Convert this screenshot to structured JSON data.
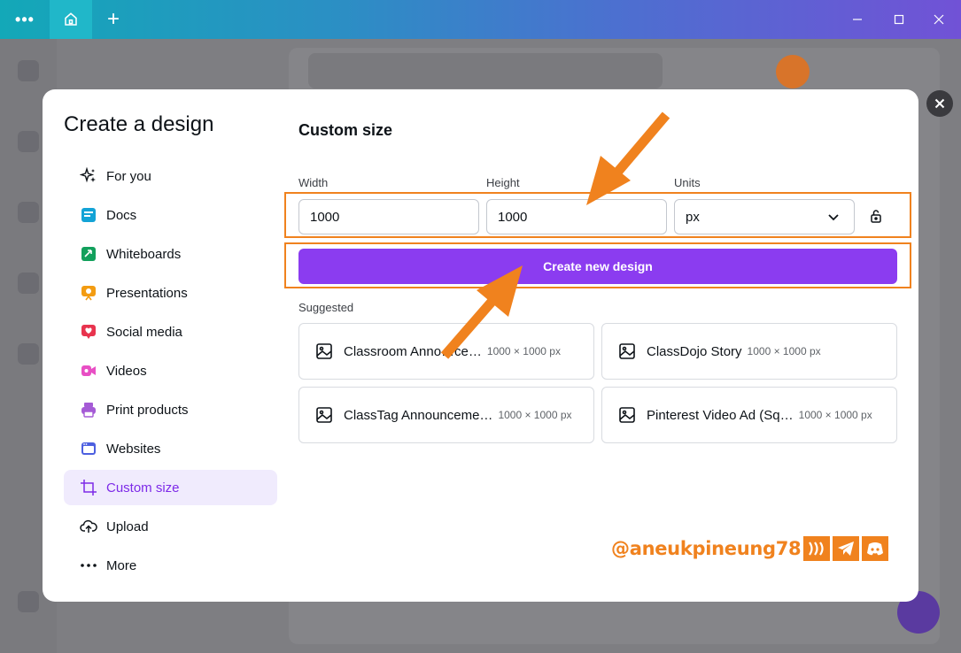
{
  "window": {
    "menu_icon": "more-dots-icon",
    "home_icon": "home-icon",
    "new_tab_icon": "plus-icon",
    "minimize_icon": "minimize-icon",
    "maximize_icon": "maximize-icon",
    "close_icon": "close-icon"
  },
  "modal": {
    "title": "Create a design",
    "nav": [
      {
        "label": "For you",
        "icon": "sparkles-icon"
      },
      {
        "label": "Docs",
        "icon": "docs-icon"
      },
      {
        "label": "Whiteboards",
        "icon": "whiteboard-icon"
      },
      {
        "label": "Presentations",
        "icon": "presentation-icon"
      },
      {
        "label": "Social media",
        "icon": "heart-icon"
      },
      {
        "label": "Videos",
        "icon": "video-icon"
      },
      {
        "label": "Print products",
        "icon": "printer-icon"
      },
      {
        "label": "Websites",
        "icon": "website-icon"
      },
      {
        "label": "Custom size",
        "icon": "crop-icon",
        "active": true
      },
      {
        "label": "Upload",
        "icon": "cloud-upload-icon"
      },
      {
        "label": "More",
        "icon": "more-dots-icon"
      }
    ],
    "custom_size": {
      "title": "Custom size",
      "width_label": "Width",
      "height_label": "Height",
      "units_label": "Units",
      "width_value": "1000",
      "height_value": "1000",
      "units_value": "px",
      "lock_icon": "lock-icon",
      "create_button": "Create new design"
    },
    "suggested": {
      "label": "Suggested",
      "items": [
        {
          "name": "Classroom Anno…ce…",
          "size": "1000 × 1000 px"
        },
        {
          "name": "ClassDojo Story",
          "size": "1000 × 1000 px"
        },
        {
          "name": "ClassTag Announceme…",
          "size": "1000 × 1000 px"
        },
        {
          "name": "Pinterest Video Ad (Sq…",
          "size": "1000 × 1000 px"
        }
      ]
    }
  },
  "watermark": {
    "handle": "@aneukpineung78",
    "badges": [
      "steem-icon",
      "telegram-icon",
      "discord-icon"
    ],
    "color": "#f0821e"
  },
  "colors": {
    "accent": "#8b3cf0",
    "highlight": "#f0821e",
    "active_bg": "#f0ebfd"
  }
}
